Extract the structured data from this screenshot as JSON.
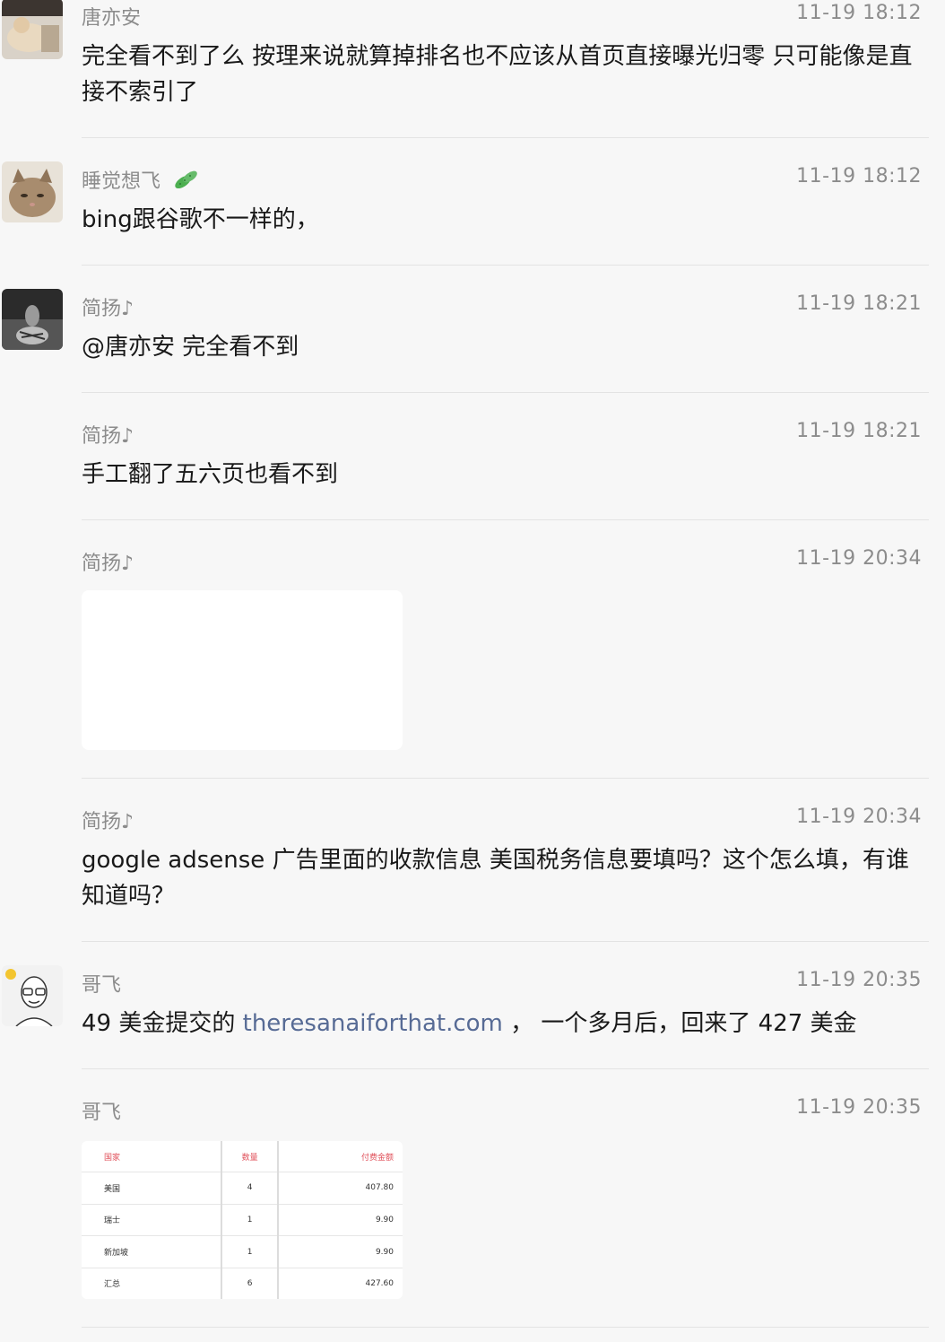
{
  "messages": [
    {
      "name": "唐亦安",
      "time": "11-19 18:12",
      "text": "完全看不到了么 按理来说就算掉排名也不应该从首页直接曝光归零 只可能像是直接不索引了"
    },
    {
      "name": "睡觉想飞",
      "name_icon": "cucumber-icon",
      "time": "11-19 18:12",
      "text": "bing跟谷歌不一样的，"
    },
    {
      "name": "简扬♪",
      "time": "11-19 18:21",
      "text": "@唐亦安 完全看不到"
    },
    {
      "name": "简扬♪",
      "time": "11-19 18:21",
      "text": "手工翻了五六页也看不到"
    },
    {
      "name": "简扬♪",
      "time": "11-19 20:34",
      "image": "blank-image"
    },
    {
      "name": "简扬♪",
      "time": "11-19 20:34",
      "text": "google adsense 广告里面的收款信息 美国税务信息要填吗？这个怎么填，有谁知道吗？"
    },
    {
      "name": "哥飞",
      "time": "11-19 20:35",
      "text_before": "49 美金提交的 ",
      "link": "theresanaiforthat.com",
      "text_after": " ， 一个多月后，回来了 427 美金"
    },
    {
      "name": "哥飞",
      "time": "11-19 20:35",
      "image": "table-image"
    }
  ],
  "table_image": {
    "headers": [
      "国家",
      "数量",
      "付费金额"
    ],
    "rows": [
      [
        "美国",
        "4",
        "407.80"
      ],
      [
        "瑞士",
        "1",
        "9.90"
      ],
      [
        "新加坡",
        "1",
        "9.90"
      ],
      [
        "汇总",
        "6",
        "427.60"
      ]
    ]
  },
  "colors": {
    "link": "#576b95",
    "meta": "#8c8c8c",
    "text": "#191919",
    "background": "#f7f7f7"
  }
}
